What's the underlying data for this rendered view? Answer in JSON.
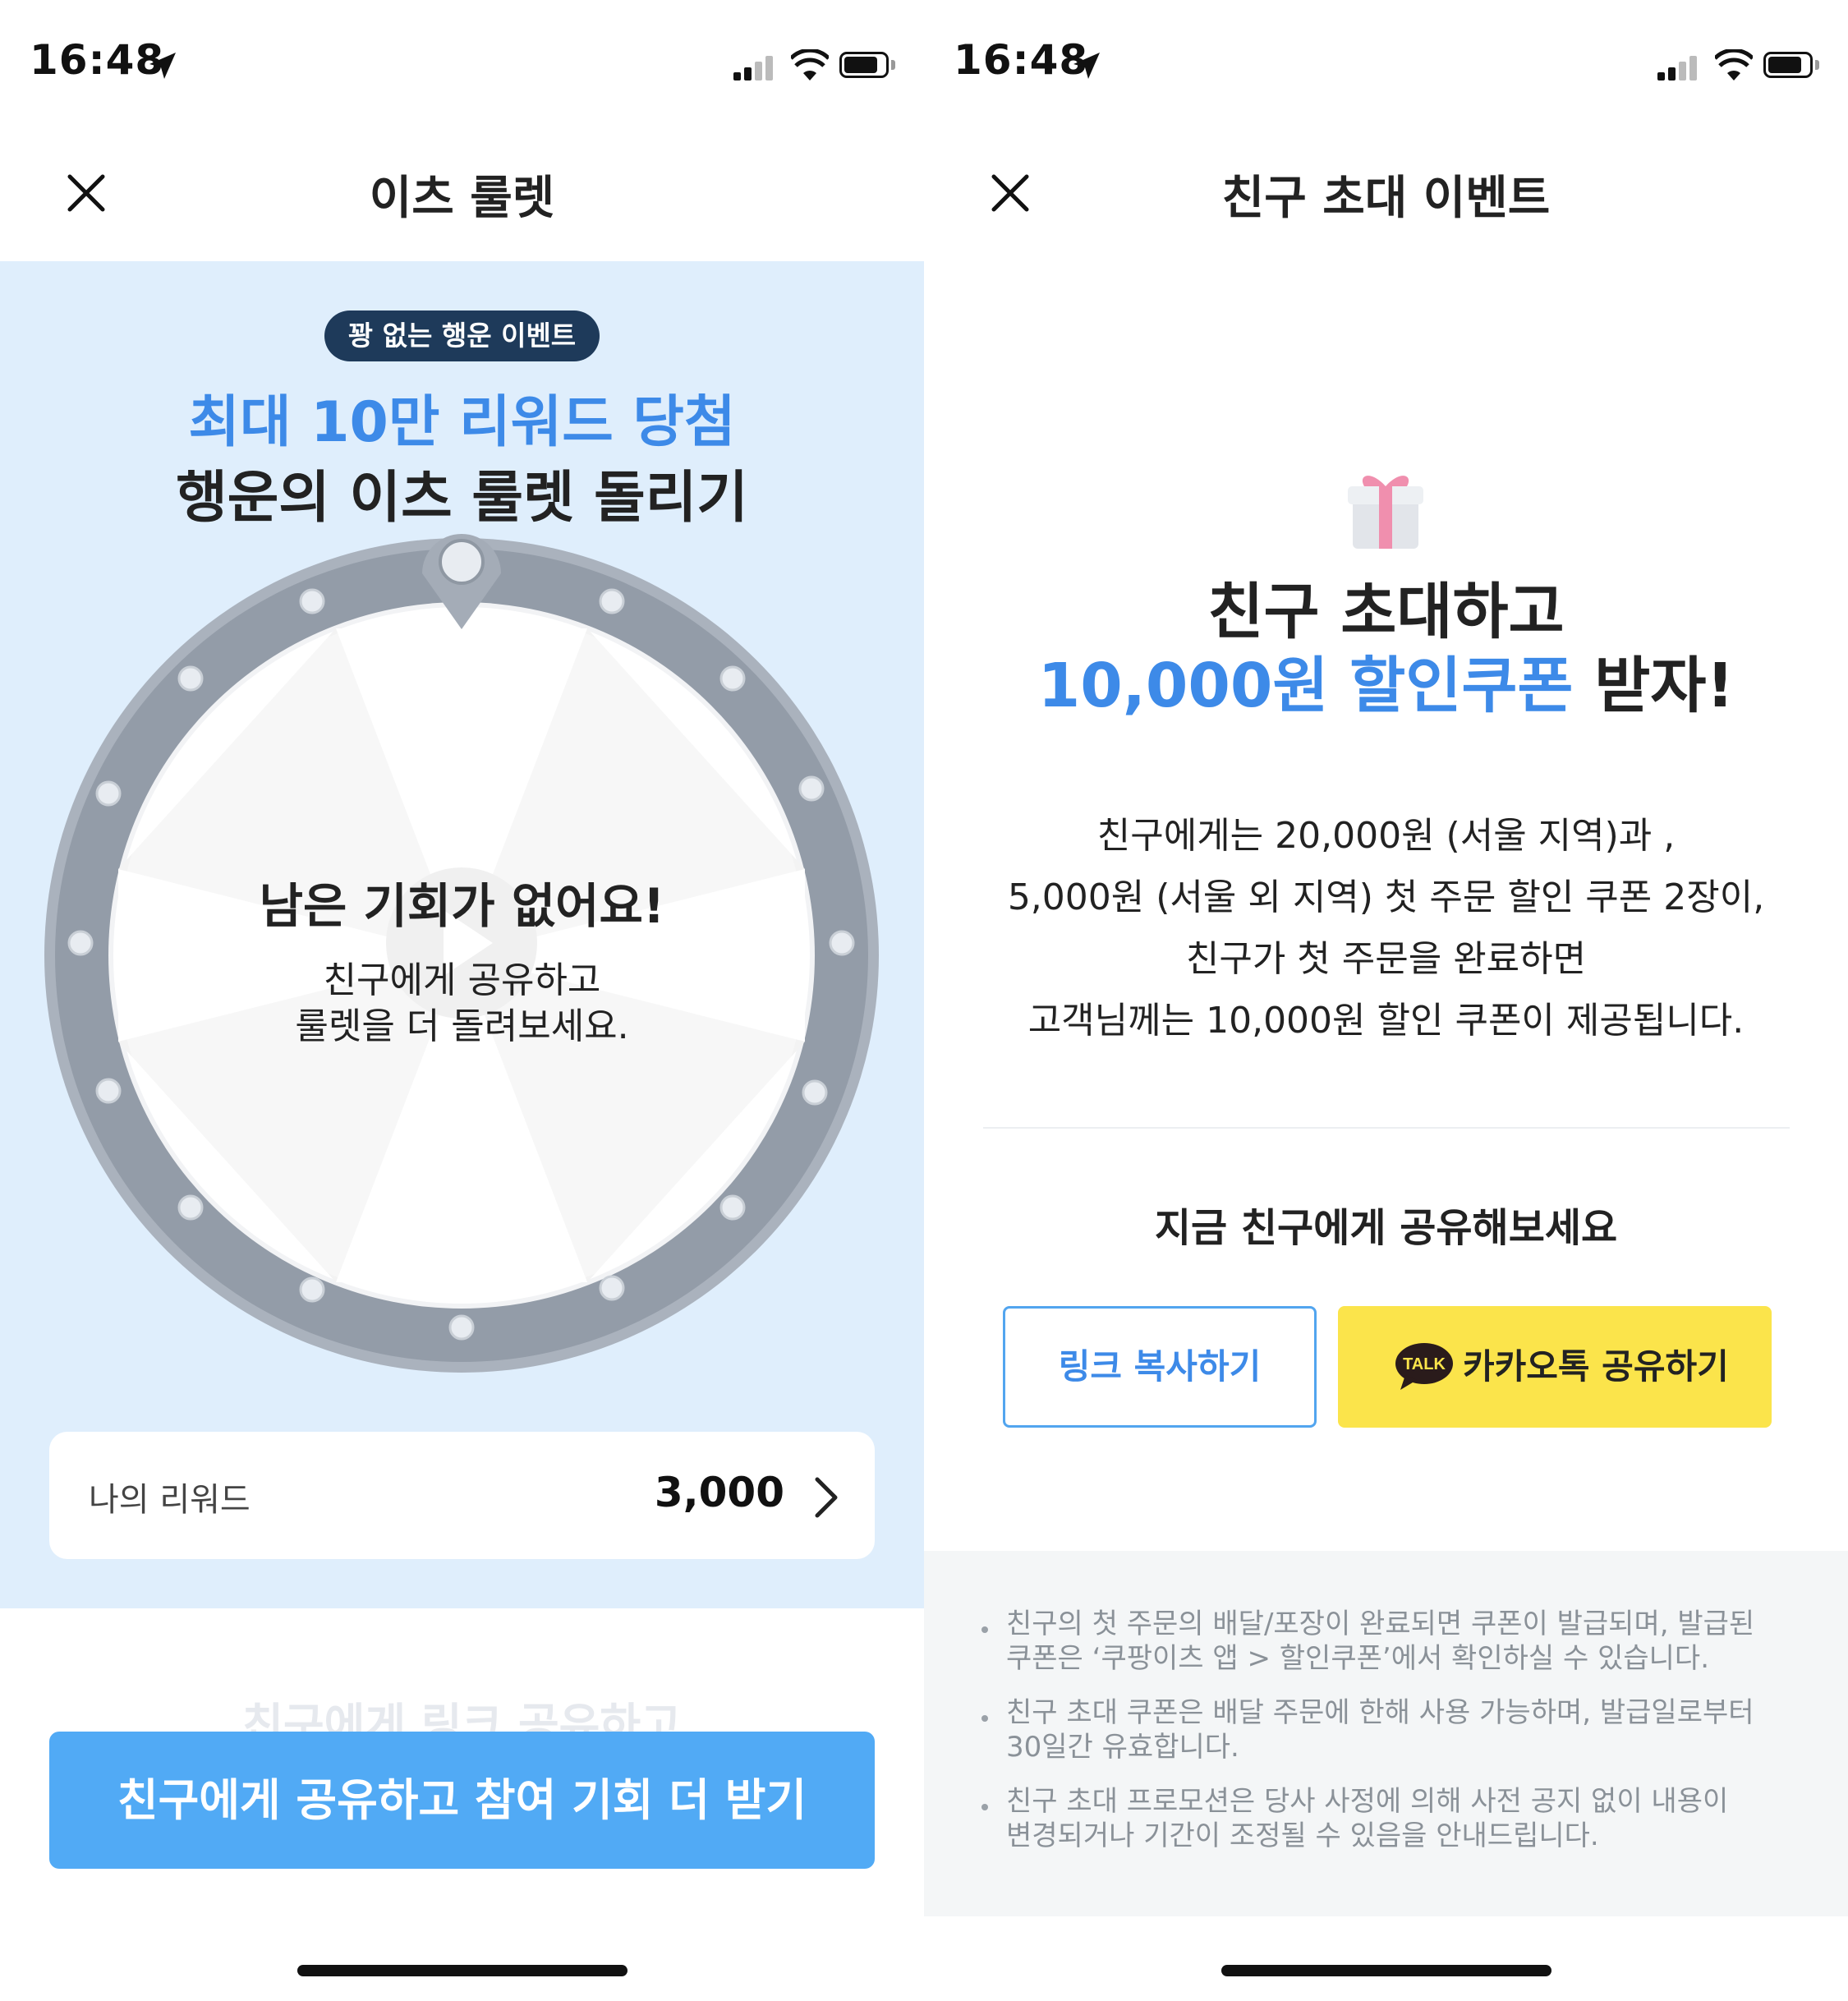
{
  "left": {
    "status": {
      "time": "16:48"
    },
    "nav": {
      "title": "이츠 룰렛"
    },
    "event": {
      "badge": "꽝 없는 행운 이벤트",
      "headline_blue": "최대 10만 리워드 당첨",
      "headline_black": "행운의 이츠 룰렛 돌리기"
    },
    "wheel": {
      "message_title": "남은 기회가 없어요!",
      "message_line1": "친구에게 공유하고",
      "message_line2": "룰렛을 더 돌려보세요."
    },
    "reward": {
      "label": "나의 리워드",
      "value": "3,000"
    },
    "share_peek": "친구에게 링크 공유하고",
    "cta": "친구에게 공유하고 참여 기회 더 받기"
  },
  "right": {
    "status": {
      "time": "16:48"
    },
    "nav": {
      "title": "친구 초대 이벤트"
    },
    "headline_line1": "친구 초대하고",
    "headline_blue": "10,000원 할인쿠폰",
    "headline_end": "받자!",
    "description": [
      "친구에게는 20,000원 (서울 지역)과 ,",
      "5,000원 (서울 외 지역) 첫 주문 할인 쿠폰 2장이,",
      "친구가 첫 주문을 완료하면",
      "고객님께는 10,000원 할인 쿠폰이 제공됩니다."
    ],
    "share_title": "지금 친구에게 공유해보세요",
    "link_button": "링크 복사하기",
    "kakao_button": "카카오톡 공유하기",
    "kakao_icon_text": "TALK",
    "notices": [
      {
        "line1": "친구의 첫 주문의 배달/포장이 완료되면 쿠폰이 발급되며, 발급된",
        "line2": "쿠폰은 ‘쿠팡이츠 앱 > 할인쿠폰’에서 확인하실 수 있습니다."
      },
      {
        "line1": "친구 초대 쿠폰은 배달 주문에 한해 사용 가능하며, 발급일로부터",
        "line2": "30일간 유효합니다."
      },
      {
        "line1": "친구 초대 프로모션은 당사 사정에 의해 사전 공지 없이 내용이",
        "line2": "변경되거나 기간이 조정될 수 있음을 안내드립니다."
      }
    ]
  },
  "colors": {
    "accent_blue": "#3d8ae8",
    "cta_blue": "#51aaf5",
    "roulette_bg": "#dfeefc",
    "badge_navy": "#1e3a5a",
    "kakao_yellow": "#fbe44b"
  }
}
